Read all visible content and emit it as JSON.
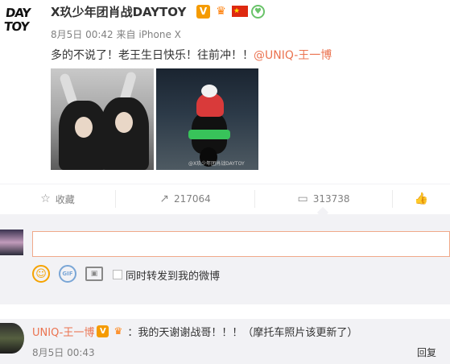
{
  "post": {
    "avatar_logo": "DAY TOY",
    "author": "X玖少年团肖战DAYTOY",
    "badges": {
      "verified": "V",
      "crown": "♛",
      "flag": "★",
      "heart": "♥"
    },
    "date": "8月5日 00:42",
    "source": "来自 iPhone X",
    "text": "多的不说了！老王生日快乐！往前冲！！",
    "mention": "@UNIQ-王一博",
    "photo2_watermark": "@X玖少年团肖战DAYTOY"
  },
  "actions": {
    "favorite_label": "收藏",
    "forward_count": "217064",
    "comment_count": "313738",
    "icons": {
      "favorite": "☆",
      "forward": "↗",
      "comment": "▭",
      "like": "👍"
    }
  },
  "compose": {
    "input_value": "",
    "icons": {
      "emoji": "☺",
      "gif": "GIF",
      "image": "▣"
    },
    "repost_checkbox_label": "同时转发到我的微博"
  },
  "comment": {
    "user": "UNIQ-王一博",
    "verified": "V",
    "crown": "♛",
    "text": "：我的天谢谢战哥！！！（摩托车照片该更新了）",
    "time": "8月5日 00:43",
    "reply_label": "回复"
  },
  "colors": {
    "accent": "#eb7350",
    "verified": "#f59b00",
    "meta": "#808080"
  }
}
